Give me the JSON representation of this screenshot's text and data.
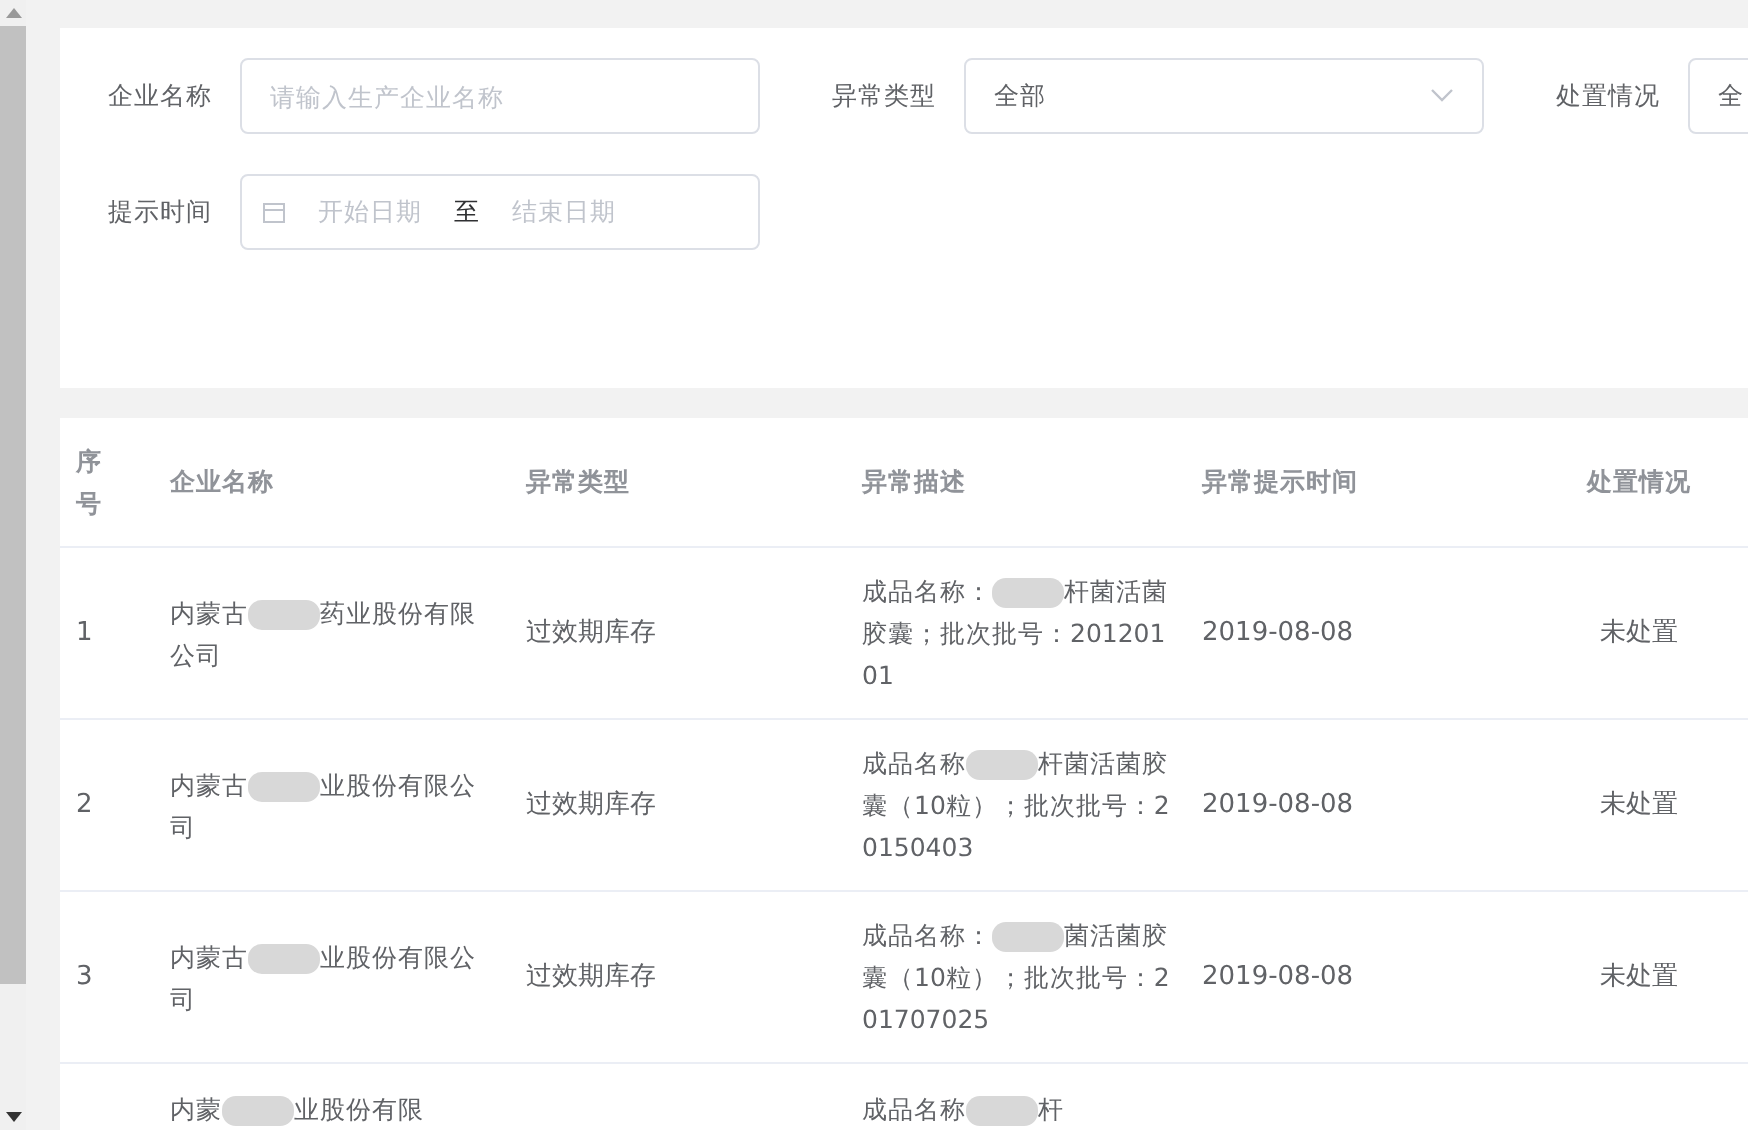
{
  "filters": [
    {
      "label": "企业名称",
      "kind": "text",
      "placeholder": "请输入生产企业名称"
    },
    {
      "label": "异常类型",
      "kind": "select",
      "value": "全部"
    },
    {
      "label": "处置情况",
      "kind": "select",
      "value": "全"
    },
    {
      "label": "提示时间",
      "kind": "daterange",
      "start_placeholder": "开始日期",
      "separator": "至",
      "end_placeholder": "结束日期"
    }
  ],
  "table": {
    "columns": [
      "序号",
      "企业名称",
      "异常类型",
      "异常描述",
      "异常提示时间",
      "处置情况"
    ],
    "rows": [
      {
        "index": "1",
        "company_before": "内蒙古",
        "company_after": "药业股份有限公司",
        "type": "过效期库存",
        "desc_before": "成品名称：",
        "desc_after": "杆菌活菌胶囊；批次批号：20120101",
        "time": "2019-08-08",
        "status": "未处置"
      },
      {
        "index": "2",
        "company_before": "内蒙古",
        "company_after": "业股份有限公司",
        "type": "过效期库存",
        "desc_before": "成品名称",
        "desc_after": "杆菌活菌胶囊（10粒）；批次批号：20150403",
        "time": "2019-08-08",
        "status": "未处置"
      },
      {
        "index": "3",
        "company_before": "内蒙古",
        "company_after": "业股份有限公司",
        "type": "过效期库存",
        "desc_before": "成品名称：",
        "desc_after": "菌活菌胶囊（10粒）；批次批号：201707025",
        "time": "2019-08-08",
        "status": "未处置"
      },
      {
        "index": "",
        "company_before": "内蒙",
        "company_after": "业股份有限",
        "type": "",
        "desc_before": "成品名称",
        "desc_after": "杆",
        "time": "",
        "status": ""
      }
    ]
  }
}
